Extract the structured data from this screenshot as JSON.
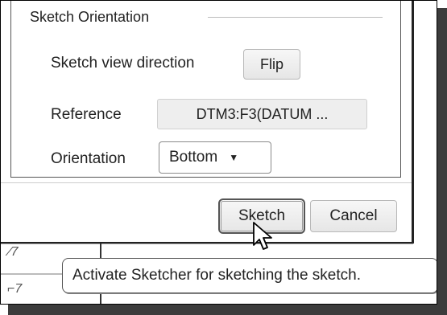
{
  "group": {
    "title": "Sketch Orientation"
  },
  "view_direction": {
    "label": "Sketch view direction",
    "button": "Flip"
  },
  "reference": {
    "label": "Reference",
    "value": "DTM3:F3(DATUM ..."
  },
  "orientation": {
    "label": "Orientation",
    "selected": "Bottom",
    "caret": "▼"
  },
  "footer": {
    "sketch_button": "Sketch",
    "cancel_button": "Cancel"
  },
  "tooltip": {
    "text": "Activate Sketcher for sketching the sketch."
  },
  "colors": {
    "frame": "#000000",
    "shadow": "#3c3c3c",
    "button_bg": "#eeeeee"
  }
}
